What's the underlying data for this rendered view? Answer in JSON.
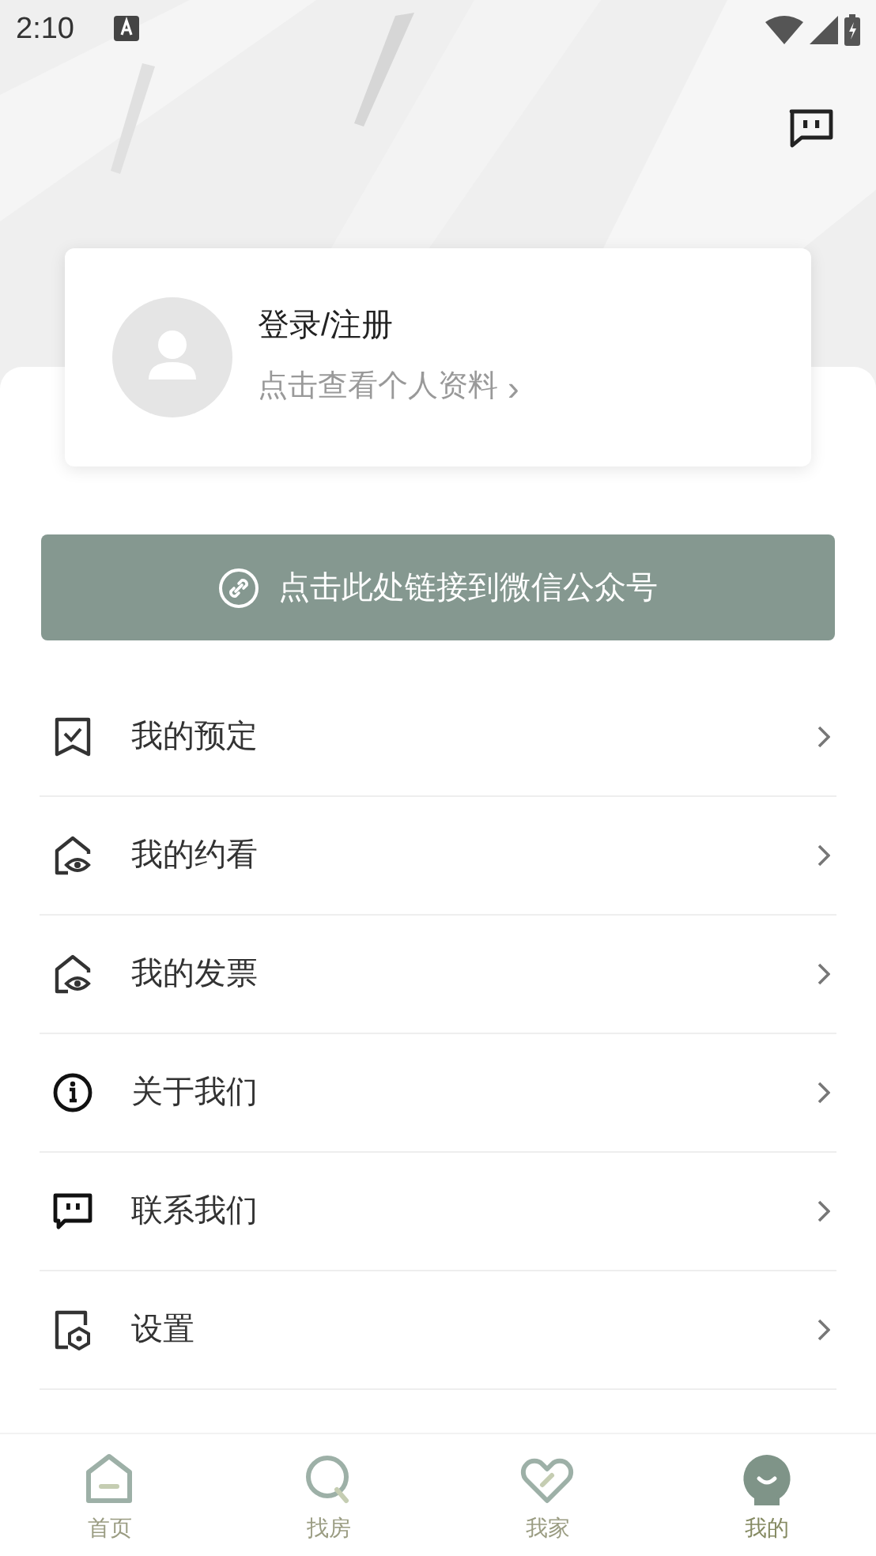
{
  "status_bar": {
    "time": "2:10"
  },
  "profile": {
    "name": "登录/注册",
    "subtitle": "点击查看个人资料",
    "chevron": "›"
  },
  "wechat_button": {
    "label": "点击此处链接到微信公众号"
  },
  "menu": [
    {
      "label": "我的预定"
    },
    {
      "label": "我的约看"
    },
    {
      "label": "我的发票"
    },
    {
      "label": "关于我们"
    },
    {
      "label": "联系我们"
    },
    {
      "label": "设置"
    }
  ],
  "tabs": [
    {
      "label": "首页",
      "selected": false
    },
    {
      "label": "找房",
      "selected": false
    },
    {
      "label": "我家",
      "selected": false
    },
    {
      "label": "我的",
      "selected": true
    }
  ]
}
